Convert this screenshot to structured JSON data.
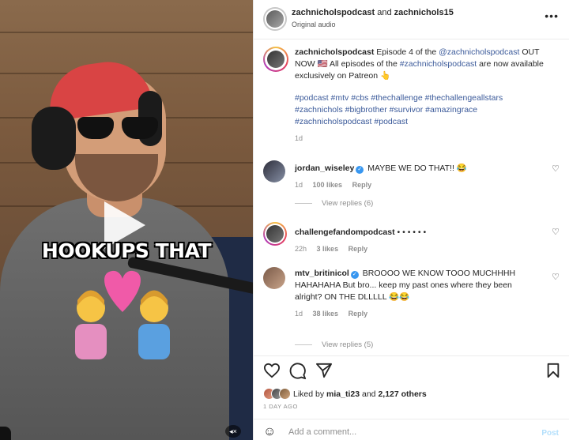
{
  "video": {
    "caption": "HOOKUPS THAT",
    "play_icon": "play-icon",
    "mute_icon": "speaker-muted-icon"
  },
  "header": {
    "user1": "zachnicholspodcast",
    "joiner": "and",
    "user2": "zachnichols15",
    "audio": "Original audio",
    "more_icon": "more-horizontal-icon"
  },
  "caption_post": {
    "username": "zachnicholspodcast",
    "text_before": "Episode 4 of the",
    "mention": "@zachnicholspodcast",
    "text_after": "OUT NOW 🇺🇸 All episodes of the",
    "hashtag_inline": "#zachnicholspodcast",
    "text_end": "are now available exclusively on Patreon 👆",
    "hashtags": "#podcast #mtv #cbs #thechallenge #thechallengeallstars #zachnichols #bigbrother #survivor #amazingrace #zachnicholspodcast #podcast",
    "time": "1d"
  },
  "comments": [
    {
      "username": "jordan_wiseley",
      "verified": true,
      "text": "MAYBE WE DO THAT!! 😂",
      "time": "1d",
      "likes": "100 likes",
      "reply": "Reply",
      "view_replies": "View replies (6)"
    },
    {
      "username": "challengefandompodcast",
      "verified": false,
      "text": "• • • • • •",
      "time": "22h",
      "likes": "3 likes",
      "reply": "Reply"
    },
    {
      "username": "mtv_britinicol",
      "verified": true,
      "text": "BROOOO WE KNOW TOOO MUCHHHH HAHAHAHA But bro... keep my past ones where they been alright? ON THE DLLLLL 😂😂",
      "time": "1d",
      "likes": "38 likes",
      "reply": "Reply",
      "view_replies": "View replies (5)"
    }
  ],
  "actions": {
    "like_icon": "heart-icon",
    "comment_icon": "comment-icon",
    "share_icon": "paper-plane-icon",
    "save_icon": "bookmark-icon"
  },
  "likes": {
    "prefix": "Liked by",
    "user": "mia_ti23",
    "joiner": "and",
    "others": "2,127 others"
  },
  "date": "1 DAY AGO",
  "add_comment": {
    "placeholder": "Add a comment...",
    "post_label": "Post",
    "emoji_icon": "smiley-icon"
  },
  "colors": {
    "link": "#3b5a9a",
    "verified": "#3897f0",
    "muted_text": "#8e8e8e",
    "post_disabled": "#b2dffc"
  }
}
